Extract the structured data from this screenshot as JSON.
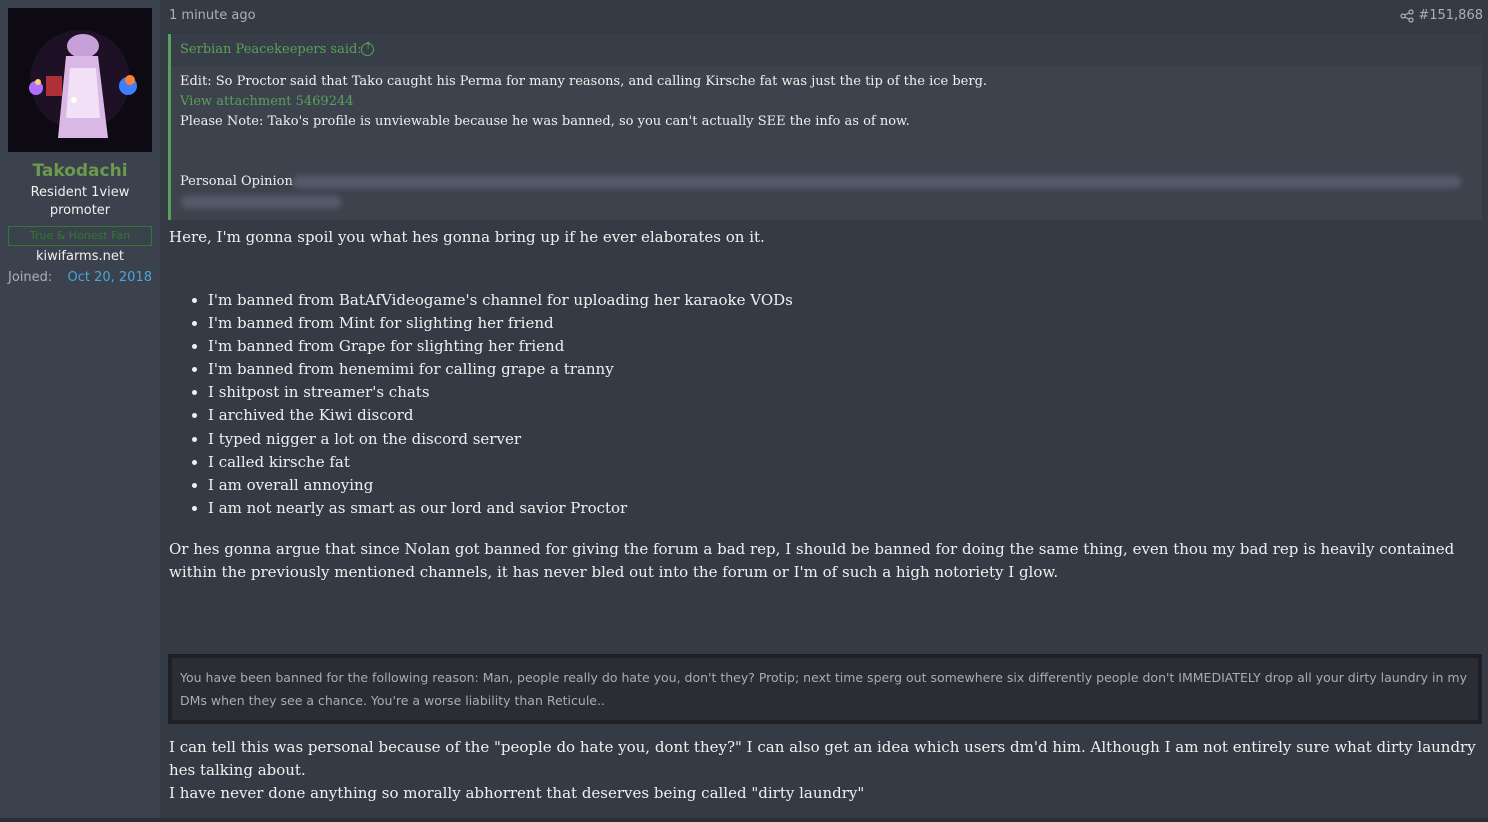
{
  "user": {
    "username": "Takodachi",
    "title": "Resident 1view promoter",
    "banner": "True & Honest Fan",
    "site": "kiwifarms.net",
    "joined_label": "Joined:",
    "joined_date": "Oct 20, 2018"
  },
  "post": {
    "time": "1 minute ago",
    "number": "#151,868"
  },
  "quote": {
    "author": "Serbian Peacekeepers said:",
    "line1": "Edit: So Proctor said that Tako caught his Perma for many reasons, and calling Kirsche fat was just the tip of the ice berg.",
    "attachment": "View attachment 5469244",
    "line2": "Please Note: Tako's profile is unviewable because he was banned, so you can't actually SEE the info as of now.",
    "spoiler_label": "Personal Opinion"
  },
  "body": {
    "intro": "Here, I'm gonna spoil you what hes gonna bring up if he ever elaborates on it.",
    "items": [
      "I'm banned from BatAfVideogame's channel for uploading her karaoke VODs",
      "I'm banned from Mint for slighting her friend",
      "I'm banned from Grape for slighting her friend",
      "I'm banned from henemimi for calling grape a tranny",
      "I shitpost in streamer's chats",
      "I archived the Kiwi discord",
      "I typed nigger a lot on the discord server",
      "I called kirsche fat",
      "I am overall annoying",
      "I am not nearly as smart as our lord and savior Proctor"
    ],
    "para2": "Or hes gonna argue that since Nolan got banned for giving the forum a bad rep, I should be banned for doing the same thing, even thou my bad rep is heavily contained within the previously mentioned channels, it has never bled out into the forum or I'm of such a high notoriety I glow.",
    "ban_message": "You have been banned for the following reason: Man, people really do hate you, don't they? Protip; next time sperg out somewhere six differently people don't IMMEDIATELY drop all your dirty laundry in my DMs when they see a chance. You're a worse liability than Reticule..",
    "para3_line1": "I can tell this was personal because of the \"people do hate you, dont they?\" I can also get an idea which users dm'd him. Although I am not entirely sure what dirty laundry hes talking about.",
    "para3_line2": "I have never done anything so morally abhorrent that deserves being called \"dirty laundry\""
  },
  "colors": {
    "username": "#6b9b4d",
    "quote_accent": "#5aa05a",
    "date_link": "#4da3d9"
  }
}
